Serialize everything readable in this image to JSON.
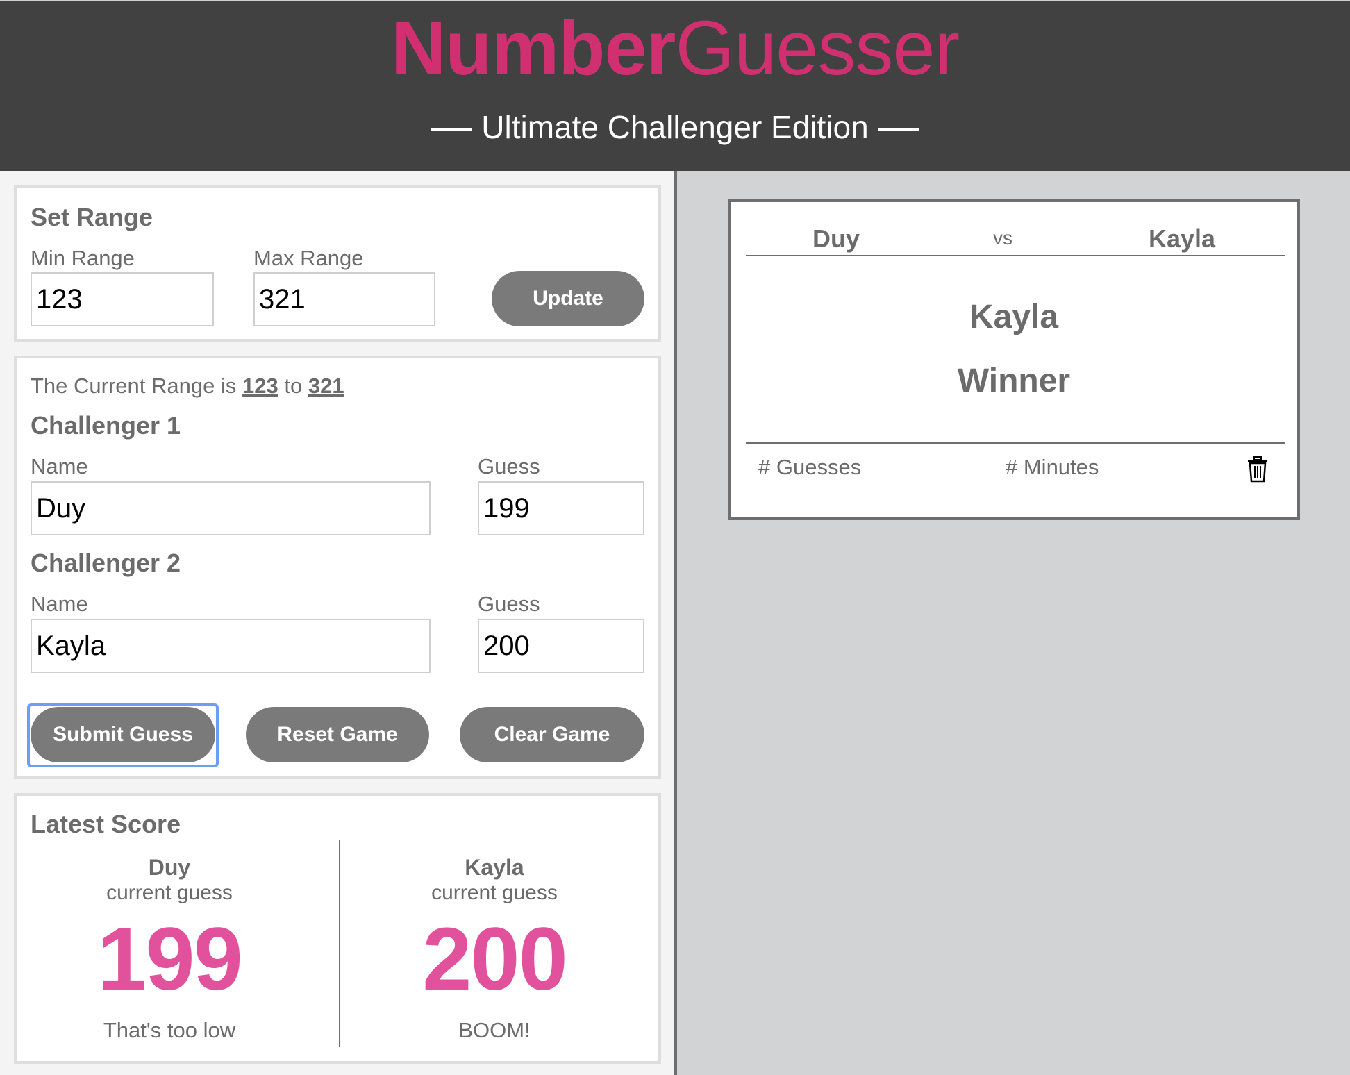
{
  "header": {
    "brand_bold": "Number",
    "brand_light": "Guesser",
    "subtitle": "Ultimate Challenger Edition"
  },
  "set_range": {
    "title": "Set Range",
    "min_label": "Min Range",
    "max_label": "Max Range",
    "min_value": "123",
    "max_value": "321",
    "update_label": "Update"
  },
  "current_range": {
    "prefix": "The Current Range is",
    "min": "123",
    "connector": "to",
    "max": "321"
  },
  "challenger1": {
    "title": "Challenger 1",
    "name_label": "Name",
    "guess_label": "Guess",
    "name_value": "Duy",
    "guess_value": "199"
  },
  "challenger2": {
    "title": "Challenger 2",
    "name_label": "Name",
    "guess_label": "Guess",
    "name_value": "Kayla",
    "guess_value": "200"
  },
  "actions": {
    "submit_label": "Submit Guess",
    "reset_label": "Reset Game",
    "clear_label": "Clear Game"
  },
  "latest_score": {
    "title": "Latest Score",
    "players": [
      {
        "name": "Duy",
        "sub": "current guess",
        "guess": "199",
        "message": "That's too low"
      },
      {
        "name": "Kayla",
        "sub": "current guess",
        "guess": "200",
        "message": "BOOM!"
      }
    ]
  },
  "result_card": {
    "player1": "Duy",
    "vs": "vs",
    "player2": "Kayla",
    "winner_name": "Kayla",
    "winner_label": "Winner",
    "guesses_label": "# Guesses",
    "minutes_label": "# Minutes",
    "delete_icon": "trash-icon"
  },
  "colors": {
    "header_bg": "#414141",
    "brand": "#d0306f",
    "score_pink": "#e2519c",
    "button_gray": "#7a7a7a",
    "page_gray": "#d2d3d5"
  }
}
